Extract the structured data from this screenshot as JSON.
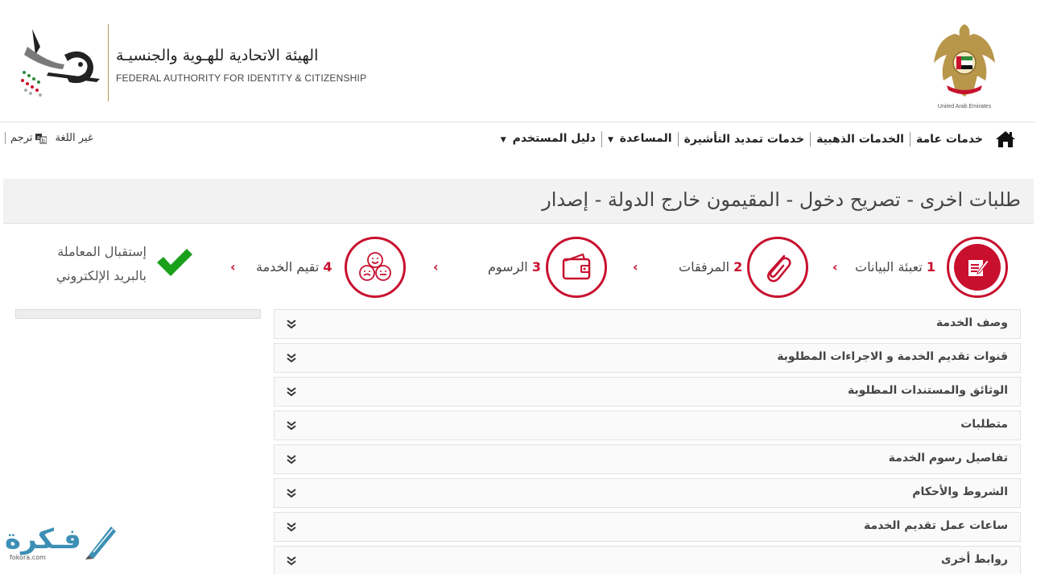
{
  "header": {
    "authority_ar": "الهيئة الاتحادية للهـوية والجنسيـة",
    "authority_en": "FEDERAL AUTHORITY FOR IDENTITY & CITIZENSHIP",
    "emblem_caption": "United Arab Emirates"
  },
  "nav": {
    "items": [
      {
        "label": "خدمات عامة",
        "dropdown": false
      },
      {
        "label": "الخدمات الذهبية",
        "dropdown": false
      },
      {
        "label": "خدمات تمديد التأشيرة",
        "dropdown": false
      },
      {
        "label": "المساعدة",
        "dropdown": true
      },
      {
        "label": "دليل المستخدم",
        "dropdown": true
      }
    ],
    "change_language": "غير اللغة",
    "translate": "ترجم"
  },
  "page_title": "طلبات اخرى - تصريح دخول - المقيمون خارج الدولة - إصدار",
  "steps": [
    {
      "num": "1",
      "label": "تعبئة البيانات",
      "icon": "form-edit-icon"
    },
    {
      "num": "2",
      "label": "المرفقات",
      "icon": "paperclip-icon"
    },
    {
      "num": "3",
      "label": "الرسوم",
      "icon": "wallet-icon"
    },
    {
      "num": "4",
      "label": "تقيم الخدمة",
      "icon": "faces-rating-icon"
    }
  ],
  "final_step": {
    "line1": "إستقبال المعاملة",
    "line2": "بالبريد الإلكتروني",
    "icon": "checkmark-icon"
  },
  "accordion": [
    "وصف الخدمة",
    "قنوات تقديم الخدمة و الاجراءات المطلوبة",
    "الوثائق والمستندات المطلوبة",
    "متطلبات",
    "تفاصيل رسوم الخدمة",
    "الشروط والأحكام",
    "ساعات عمل تقديم الخدمة",
    "روابط أخرى"
  ],
  "watermark": {
    "text": "فـكرة",
    "url": "fokora.com"
  },
  "colors": {
    "accent": "#c8102e",
    "check": "#1aa01a",
    "watermark": "#3d8fb5"
  }
}
